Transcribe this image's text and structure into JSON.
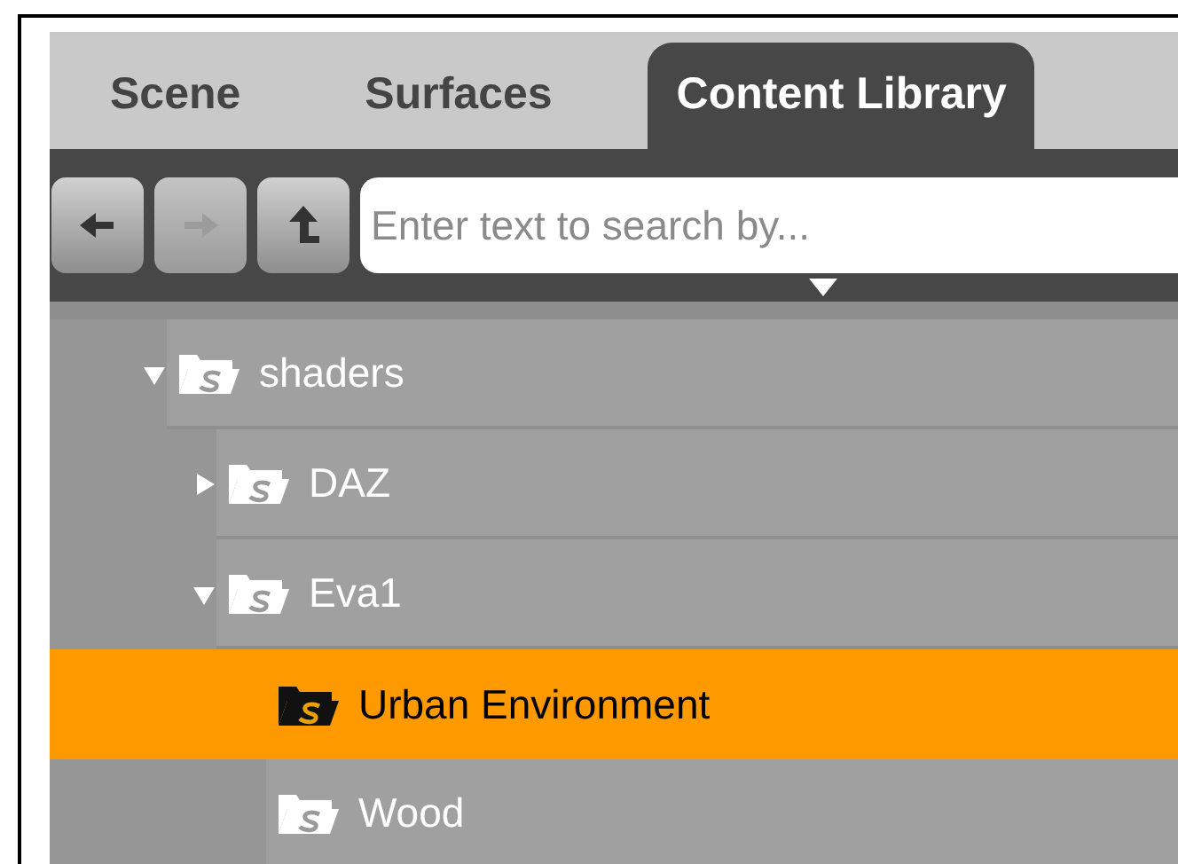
{
  "tabs": [
    {
      "label": "Scene",
      "selected": false
    },
    {
      "label": "Surfaces",
      "selected": false
    },
    {
      "label": "Content Library",
      "selected": true
    }
  ],
  "nav_buttons": [
    {
      "kind": "back",
      "disabled": false
    },
    {
      "kind": "forward",
      "disabled": true
    },
    {
      "kind": "up",
      "disabled": false
    }
  ],
  "search": {
    "placeholder": "Enter text to search by..."
  },
  "tree": [
    {
      "label": "shaders",
      "expanded": true,
      "selected": false,
      "children": [
        {
          "label": "DAZ",
          "expanded": false,
          "selected": false
        },
        {
          "label": "Eva1",
          "expanded": true,
          "selected": false,
          "children": [
            {
              "label": "Urban Environment",
              "selected": true
            },
            {
              "label": "Wood",
              "selected": false
            }
          ]
        }
      ]
    }
  ]
}
